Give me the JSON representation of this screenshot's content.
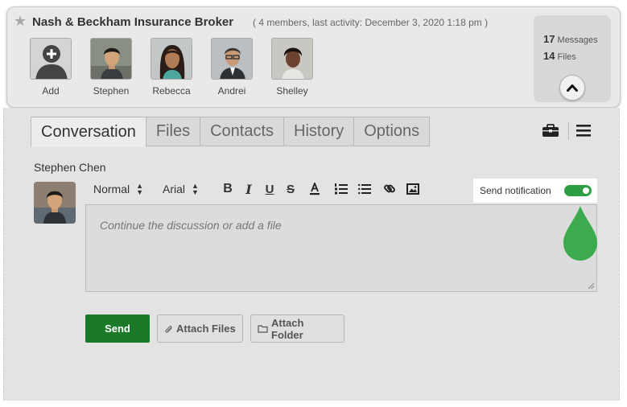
{
  "group": {
    "name": "Nash & Beckham Insurance Broker",
    "meta": "( 4 members, last activity: December 3, 2020 1:18 pm )"
  },
  "members": [
    {
      "name": "Add",
      "avatar": "add-user-icon"
    },
    {
      "name": "Stephen",
      "avatar": "avatar-stephen"
    },
    {
      "name": "Rebecca",
      "avatar": "avatar-rebecca"
    },
    {
      "name": "Andrei",
      "avatar": "avatar-andrei"
    },
    {
      "name": "Shelley",
      "avatar": "avatar-shelley"
    }
  ],
  "stats": {
    "messages_count": "17",
    "messages_label": "Messages",
    "files_count": "14",
    "files_label": "Files"
  },
  "tabs": [
    {
      "label": "Conversation",
      "active": true
    },
    {
      "label": "Files",
      "active": false
    },
    {
      "label": "Contacts",
      "active": false
    },
    {
      "label": "History",
      "active": false
    },
    {
      "label": "Options",
      "active": false
    }
  ],
  "compose": {
    "author": "Stephen Chen",
    "format": "Normal",
    "font": "Arial",
    "notification_label": "Send notification",
    "notification_on": true,
    "placeholder": "Continue the discussion or add a file"
  },
  "buttons": {
    "send": "Send",
    "attach_files": "Attach Files",
    "attach_folder": "Attach Folder"
  },
  "colors": {
    "accent_green": "#1a7a28",
    "toggle_green": "#2e9e45",
    "drop_green": "#3cab4e"
  }
}
